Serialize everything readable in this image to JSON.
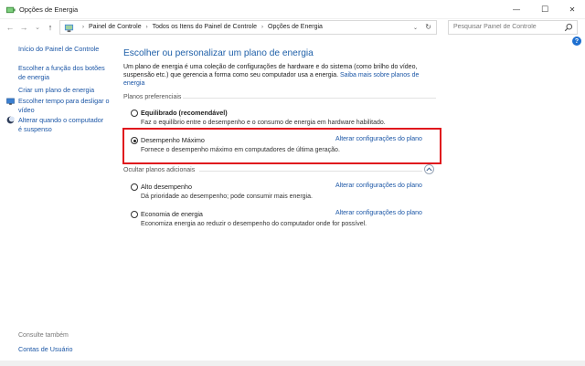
{
  "window": {
    "title": "Opções de Energia",
    "minimize_glyph": "—",
    "maximize_glyph": "☐",
    "close_glyph": "✕"
  },
  "address": {
    "back_glyph": "←",
    "forward_glyph": "→",
    "recent_glyph": "⌄",
    "up_glyph": "↑",
    "breadcrumbs": [
      "Painel de Controle",
      "Todos os Itens do Painel de Controle",
      "Opções de Energia"
    ],
    "separator": "›",
    "dropdown_glyph": "⌄",
    "refresh_glyph": "↻",
    "search_placeholder": "Pesquisar Painel de Controle",
    "help_glyph": "?"
  },
  "sidebar": {
    "home": "Início do Painel de Controle",
    "items": [
      {
        "label_line1": "Escolher a função dos botões",
        "label_line2": "de energia"
      },
      {
        "label_line1": "Criar um plano de energia"
      },
      {
        "label_line1": "Escolher tempo para desligar o",
        "label_line2": "vídeo",
        "icon": "monitor-icon"
      },
      {
        "label_line1": "Alterar quando o computador",
        "label_line2": "é suspenso",
        "icon": "moon-icon"
      }
    ],
    "see_also": "Consulte também",
    "see_also_items": [
      "Contas de Usuário"
    ]
  },
  "main": {
    "title": "Escolher ou personalizar um plano de energia",
    "intro_line1": "Um plano de energia é uma coleção de configurações de hardware e do sistema (como brilho do vídeo,",
    "intro_line2": "suspensão etc.) que gerencia a forma como seu computador usa a energia.",
    "intro_link": "Saiba mais sobre planos de energia",
    "preferred_label": "Planos preferenciais",
    "hidden_label": "Ocultar planos adicionais",
    "change_label": "Alterar configurações do plano",
    "preferred_plans": [
      {
        "name": "Equilibrado (recomendável)",
        "desc": "Faz o equilíbrio entre o desempenho e o consumo de energia em hardware habilitado.",
        "selected": false,
        "bold": true
      },
      {
        "name": "Desempenho Máximo",
        "desc": "Fornece o desempenho máximo em computadores de última geração.",
        "selected": true,
        "bold": false
      }
    ],
    "additional_plans": [
      {
        "name": "Alto desempenho",
        "desc": "Dá prioridade ao desempenho; pode consumir mais energia.",
        "selected": false
      },
      {
        "name": "Economia de energia",
        "desc": "Economiza energia ao reduzir o desempenho do computador onde for possível.",
        "selected": false
      }
    ]
  },
  "colors": {
    "link": "#1b56a6",
    "title": "#1e5fa8",
    "highlight_border": "#e0161d"
  }
}
